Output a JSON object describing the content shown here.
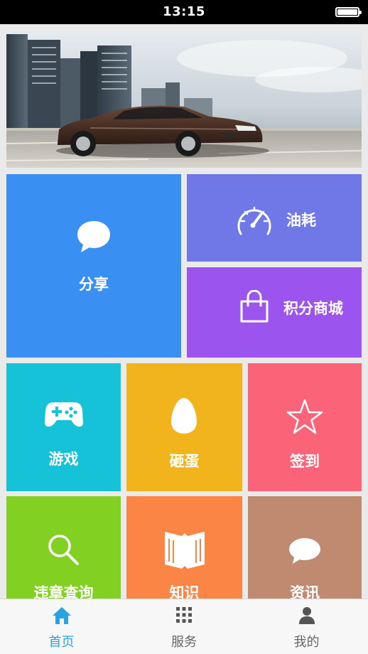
{
  "status_bar": {
    "time": "13:15"
  },
  "colors": {
    "share": "#3a8ff2",
    "fuel": "#7078e8",
    "mall": "#9b55ee",
    "games": "#16c2d8",
    "egg": "#f2b41c",
    "checkin": "#fb6478",
    "violation": "#82d021",
    "knowledge": "#fb8545",
    "news": "#c08a70",
    "tab_active": "#2aa3e0",
    "tab_inactive": "#666666"
  },
  "tiles": {
    "share": {
      "label": "分享",
      "icon": "chat-bubble-icon"
    },
    "fuel": {
      "label": "油耗",
      "icon": "speedometer-icon"
    },
    "mall": {
      "label": "积分商城",
      "icon": "shopping-bag-icon"
    },
    "games": {
      "label": "游戏",
      "icon": "gamepad-icon"
    },
    "egg": {
      "label": "砸蛋",
      "icon": "egg-icon"
    },
    "checkin": {
      "label": "签到",
      "icon": "star-icon"
    },
    "violation": {
      "label": "违章查询",
      "icon": "search-icon"
    },
    "knowledge": {
      "label": "知识",
      "icon": "book-icon"
    },
    "news": {
      "label": "资讯",
      "icon": "chat-bubble-icon"
    }
  },
  "tabbar": {
    "tabs": [
      {
        "label": "首页",
        "icon": "home-icon",
        "active": true
      },
      {
        "label": "服务",
        "icon": "grid-icon",
        "active": false
      },
      {
        "label": "我的",
        "icon": "user-icon",
        "active": false
      }
    ]
  }
}
